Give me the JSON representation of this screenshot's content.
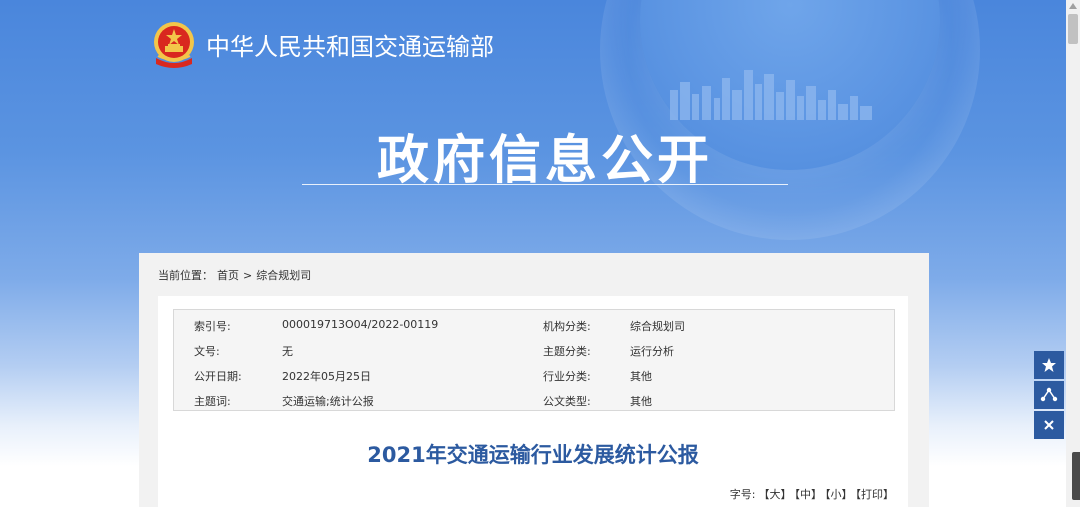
{
  "site": {
    "title": "中华人民共和国交通运输部",
    "banner_title": "政府信息公开",
    "emblem_icon": "national-emblem-icon"
  },
  "breadcrumb": {
    "label": "当前位置：",
    "home": "首页",
    "sep": ">",
    "current": "综合规划司"
  },
  "meta": {
    "rows": [
      {
        "k1": "索引号:",
        "v1": "000019713O04/2022-00119",
        "k2": "机构分类:",
        "v2": "综合规划司"
      },
      {
        "k1": "文号:",
        "v1": "无",
        "k2": "主题分类:",
        "v2": "运行分析"
      },
      {
        "k1": "公开日期:",
        "v1": "2022年05月25日",
        "k2": "行业分类:",
        "v2": "其他"
      },
      {
        "k1": "主题词:",
        "v1": "交通运输;统计公报",
        "k2": "公文类型:",
        "v2": "其他"
      }
    ]
  },
  "document": {
    "title": "2021年交通运输行业发展统计公报"
  },
  "font_controls": {
    "label": "字号:",
    "large": "【大】",
    "medium": "【中】",
    "small": "【小】",
    "print": "【打印】"
  },
  "float_tools": {
    "items": [
      "star-icon",
      "share-icon",
      "close-icon"
    ]
  },
  "colors": {
    "hero_blue": "#4a86dc",
    "accent": "#2c5aa0",
    "panel_bg": "#f2f2f2"
  }
}
